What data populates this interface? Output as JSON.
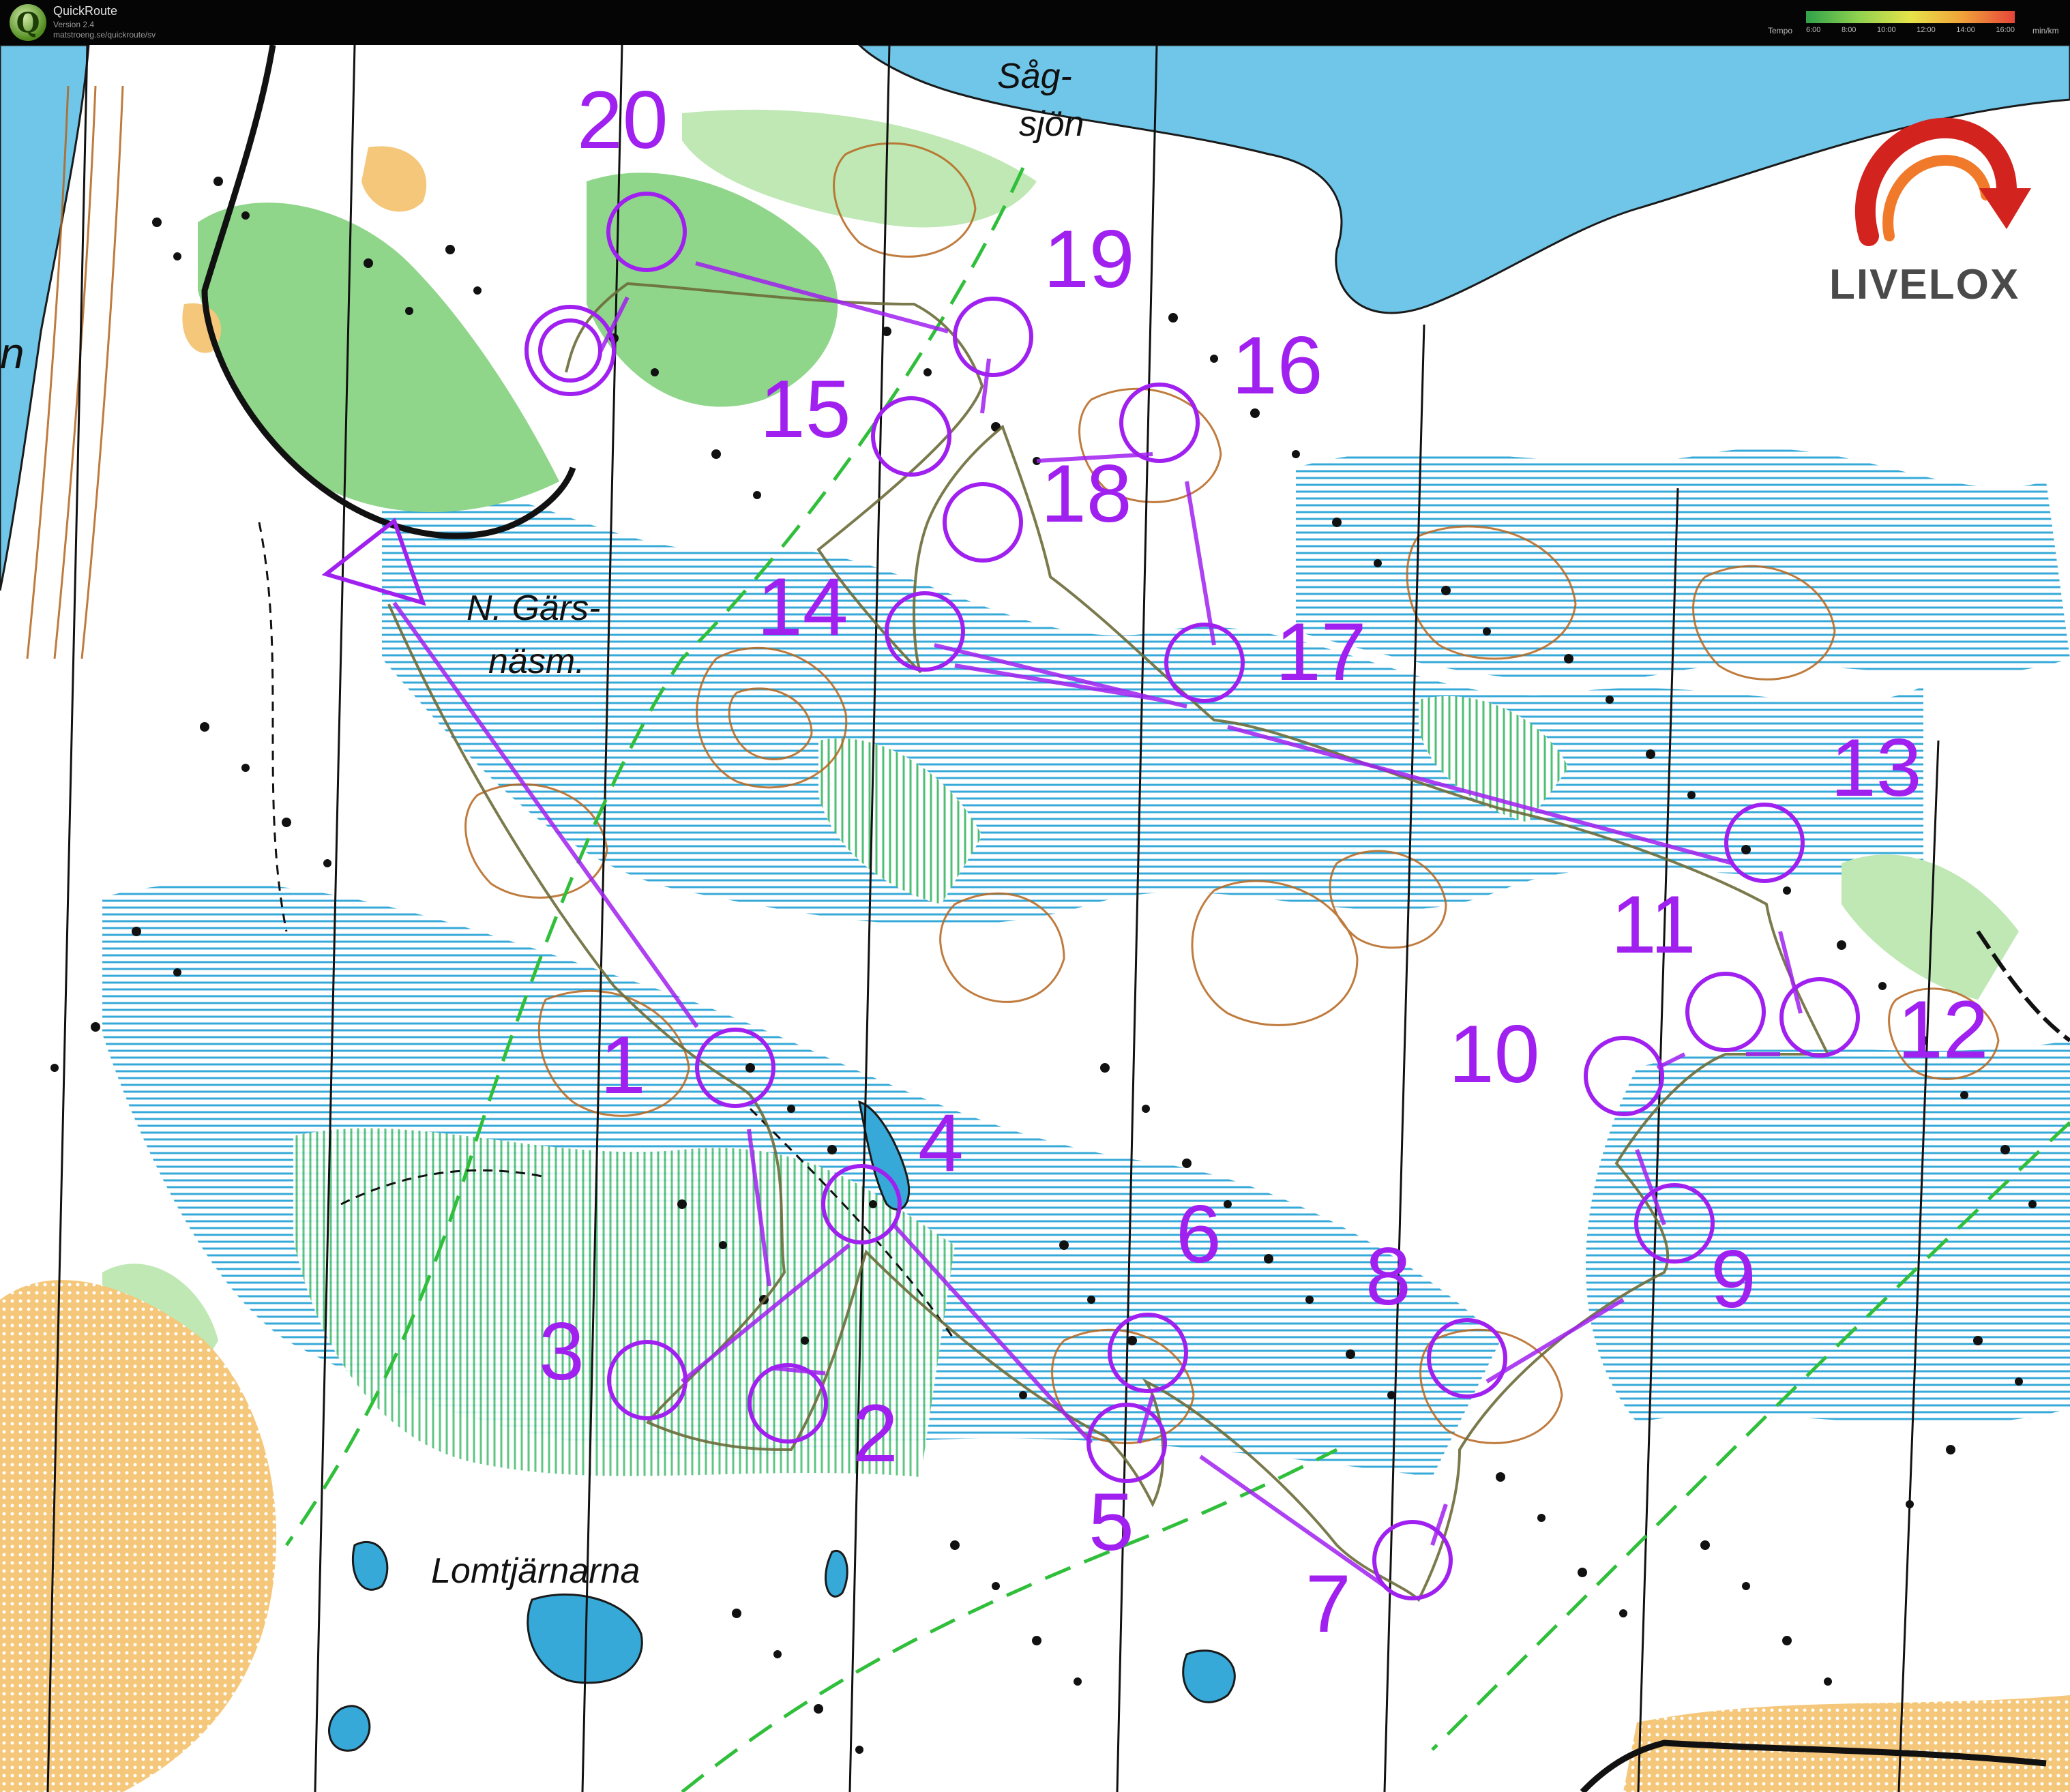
{
  "app": {
    "logo_letter": "Q",
    "name": "QuickRoute",
    "version": "Version 2.4",
    "url": "matstroeng.se/quickroute/sv"
  },
  "tempo": {
    "label": "Tempo",
    "ticks": [
      "6:00",
      "8:00",
      "10:00",
      "12:00",
      "14:00",
      "16:00"
    ],
    "unit": "min/km"
  },
  "brand": {
    "name": "LIVELOX",
    "colors": {
      "logo_red": "#d2231e",
      "logo_text": "#4a4a4a"
    }
  },
  "map": {
    "place_names": {
      "lake_north": [
        "Såg-",
        "sjön"
      ],
      "marsh_north": [
        "N. Gärs-",
        "näsm."
      ],
      "lakes_south": "Lomtjärnarna",
      "edge_letter": "n"
    },
    "course": {
      "color": "#a020f0",
      "start_icon": "start-triangle",
      "controls": [
        "1",
        "2",
        "3",
        "4",
        "5",
        "6",
        "7",
        "8",
        "9",
        "10",
        "11",
        "12",
        "13",
        "14",
        "15",
        "16",
        "17",
        "18",
        "19",
        "20"
      ],
      "finish_icon": "finish-double-circle"
    },
    "colors": {
      "water": "#6fc6e8",
      "marsh": "#36a9d8",
      "green_vegetation": "#8fd68a",
      "open_land": "#f5c77a",
      "contours": "#b5651d",
      "route": "#6b6b3a"
    }
  }
}
